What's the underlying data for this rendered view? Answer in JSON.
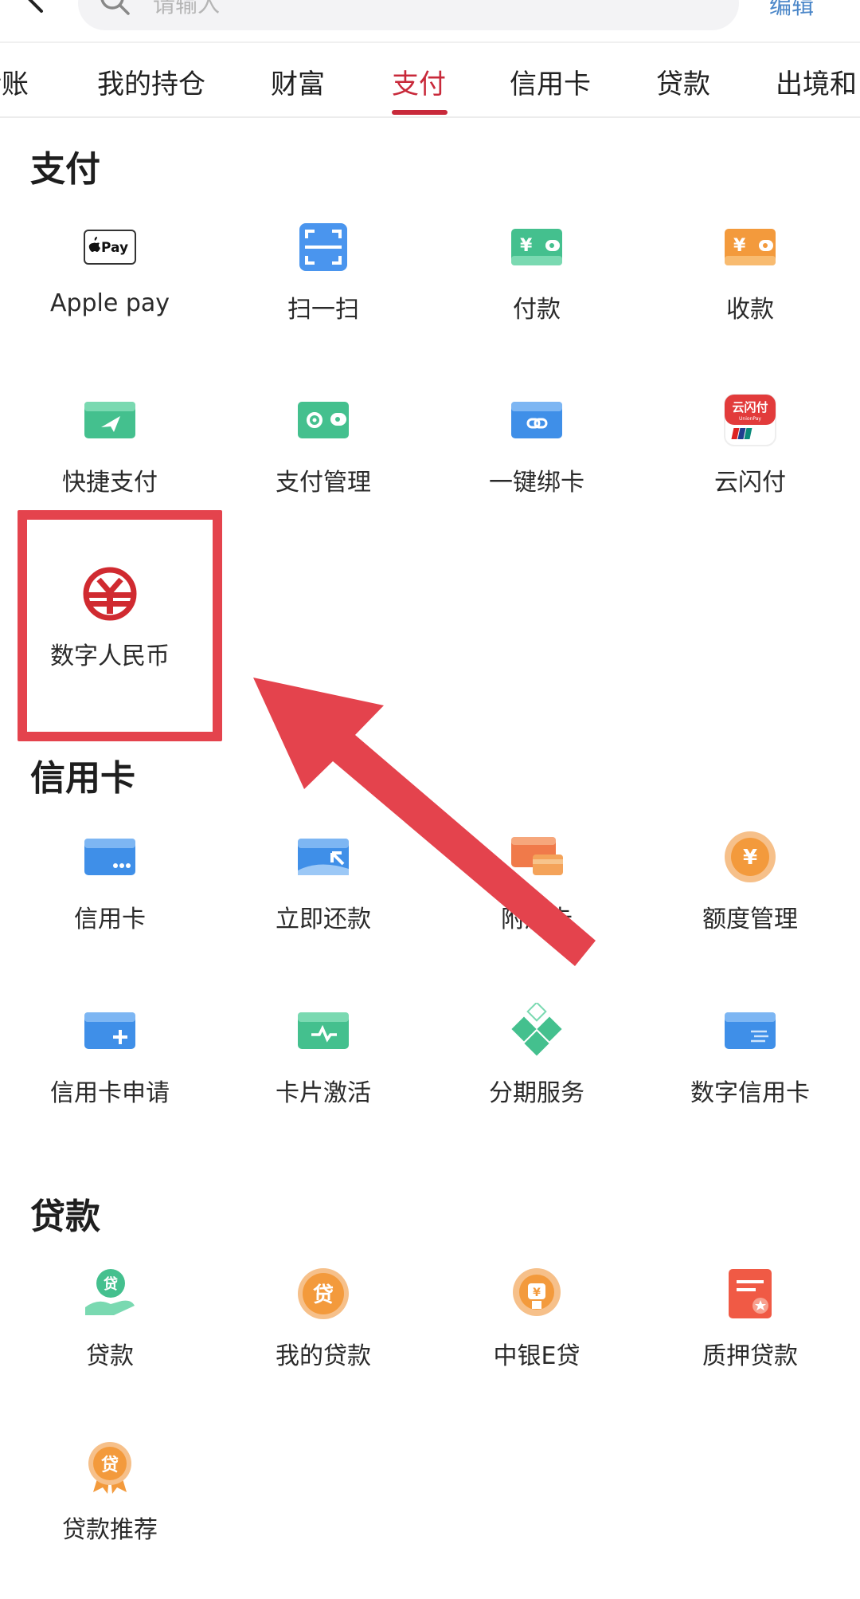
{
  "search": {
    "placeholder": "请输入",
    "edit_label": "编辑"
  },
  "tabs": [
    {
      "label": "转账",
      "active": false
    },
    {
      "label": "我的持仓",
      "active": false
    },
    {
      "label": "财富",
      "active": false
    },
    {
      "label": "支付",
      "active": true
    },
    {
      "label": "信用卡",
      "active": false
    },
    {
      "label": "贷款",
      "active": false
    },
    {
      "label": "出境和",
      "active": false
    }
  ],
  "sections": {
    "pay": {
      "title": "支付",
      "items": [
        {
          "label": "Apple pay",
          "icon": "apple-pay-icon"
        },
        {
          "label": "扫一扫",
          "icon": "scan-icon"
        },
        {
          "label": "付款",
          "icon": "payment-wallet-icon"
        },
        {
          "label": "收款",
          "icon": "receive-wallet-icon"
        },
        {
          "label": "快捷支付",
          "icon": "quick-pay-icon"
        },
        {
          "label": "支付管理",
          "icon": "pay-settings-icon"
        },
        {
          "label": "一键绑卡",
          "icon": "bind-card-icon"
        },
        {
          "label": "云闪付",
          "icon": "unionpay-quickpass-icon"
        },
        {
          "label": "数字人民币",
          "icon": "digital-rmb-icon"
        }
      ]
    },
    "credit": {
      "title": "信用卡",
      "items": [
        {
          "label": "信用卡",
          "icon": "credit-card-icon"
        },
        {
          "label": "立即还款",
          "icon": "repay-icon"
        },
        {
          "label": "附属卡",
          "icon": "supplementary-card-icon"
        },
        {
          "label": "额度管理",
          "icon": "credit-limit-icon"
        },
        {
          "label": "信用卡申请",
          "icon": "card-apply-icon"
        },
        {
          "label": "卡片激活",
          "icon": "card-activate-icon"
        },
        {
          "label": "分期服务",
          "icon": "installment-icon"
        },
        {
          "label": "数字信用卡",
          "icon": "digital-credit-card-icon"
        }
      ]
    },
    "loan": {
      "title": "贷款",
      "items": [
        {
          "label": "贷款",
          "icon": "loan-hand-icon"
        },
        {
          "label": "我的贷款",
          "icon": "my-loan-icon"
        },
        {
          "label": "中银E贷",
          "icon": "e-loan-icon"
        },
        {
          "label": "质押贷款",
          "icon": "pledge-loan-icon"
        },
        {
          "label": "贷款推荐",
          "icon": "loan-recommend-icon"
        }
      ]
    }
  },
  "icon_text": {
    "apple_pay": "Pay",
    "unionpay_title": "云闪付",
    "unionpay_sub": "UnionPay",
    "loan_glyph": "贷",
    "yuan": "¥"
  },
  "colors": {
    "accent_red": "#c8293a",
    "highlight_red": "#e4434d",
    "green": "#3fbf8a",
    "blue": "#3f8fe8",
    "orange": "#f39a3c"
  }
}
